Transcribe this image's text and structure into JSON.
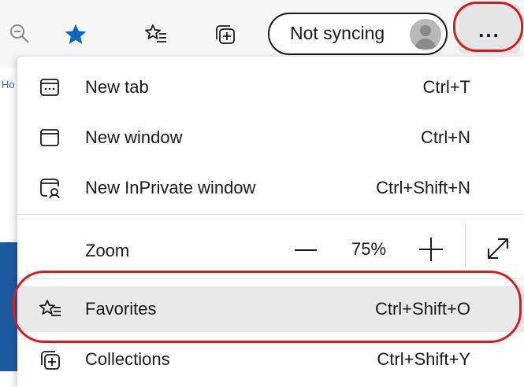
{
  "toolbar": {
    "sync_label": "Not syncing",
    "more_label": "..."
  },
  "page": {
    "hint": "Ho"
  },
  "menu": {
    "items": [
      {
        "label": "New tab",
        "shortcut": "Ctrl+T",
        "icon": "new-tab-icon"
      },
      {
        "label": "New window",
        "shortcut": "Ctrl+N",
        "icon": "new-window-icon"
      },
      {
        "label": "New InPrivate window",
        "shortcut": "Ctrl+Shift+N",
        "icon": "inprivate-icon"
      }
    ],
    "zoom": {
      "label": "Zoom",
      "value": "75%"
    },
    "favorites": {
      "label": "Favorites",
      "shortcut": "Ctrl+Shift+O",
      "icon": "favorites-icon"
    },
    "collections": {
      "label": "Collections",
      "shortcut": "Ctrl+Shift+Y",
      "icon": "collections-icon"
    }
  },
  "colors": {
    "accent": "#0a66c2",
    "annotation": "#d81b1b",
    "highlight": "#e9e9e9"
  }
}
